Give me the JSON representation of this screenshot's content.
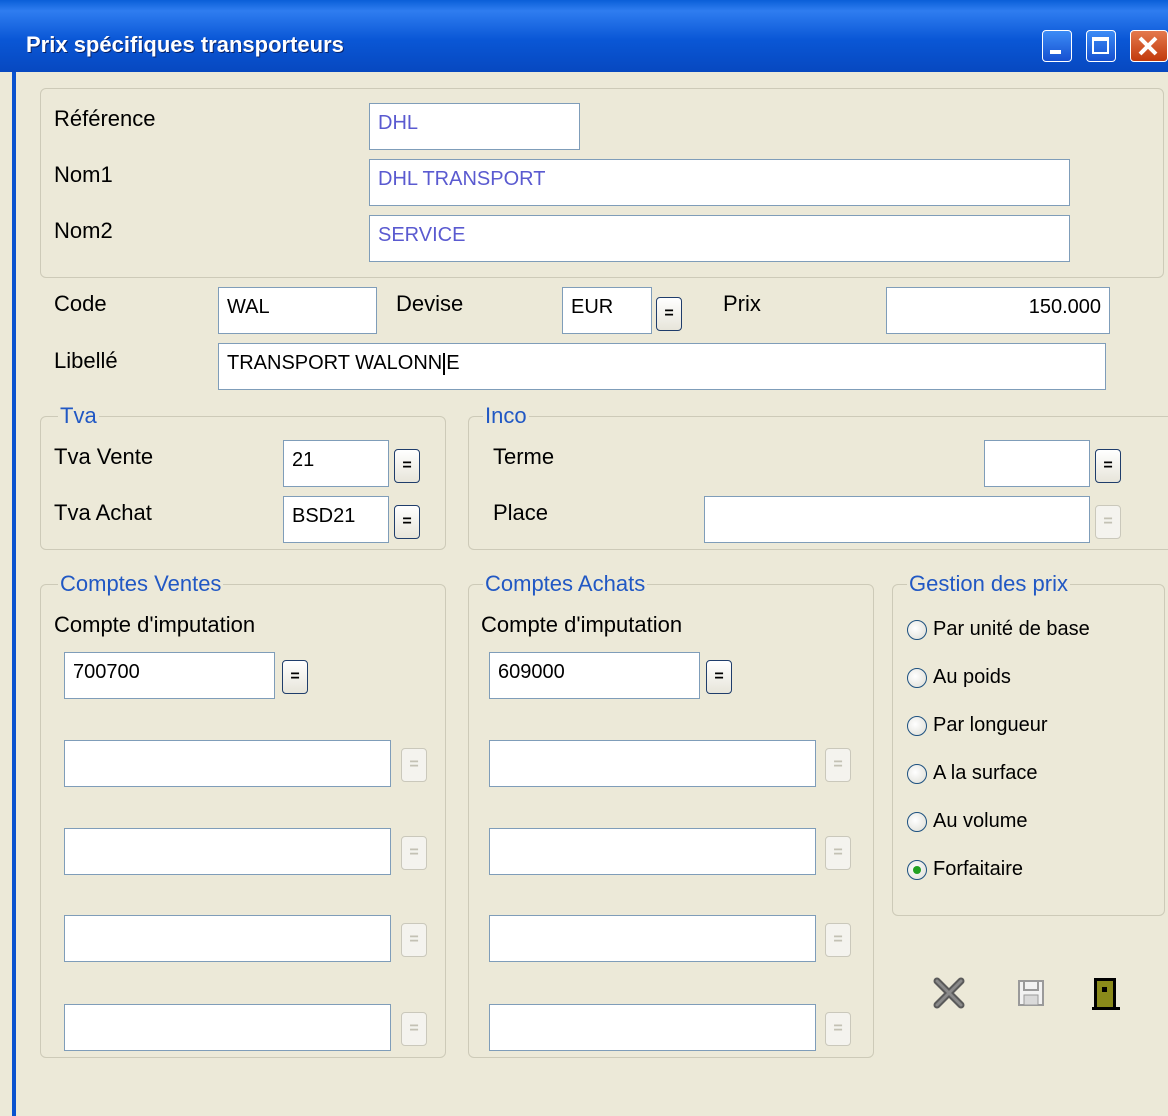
{
  "window": {
    "title": "Prix spécifiques transporteurs"
  },
  "carrier": {
    "reference_label": "Référence",
    "reference_value": "DHL",
    "nom1_label": "Nom1",
    "nom1_value": "DHL TRANSPORT",
    "nom2_label": "Nom2",
    "nom2_value": "SERVICE"
  },
  "line": {
    "code_label": "Code",
    "code_value": "WAL",
    "devise_label": "Devise",
    "devise_value": "EUR",
    "prix_label": "Prix",
    "prix_value": "150.000",
    "libelle_label": "Libellé",
    "libelle_before_caret": "TRANSPORT WALONN",
    "libelle_after_caret": "E"
  },
  "tva": {
    "legend": "Tva",
    "vente_label": "Tva Vente",
    "vente_value": "21",
    "achat_label": "Tva Achat",
    "achat_value": "BSD21"
  },
  "inco": {
    "legend": "Inco",
    "terme_label": "Terme",
    "terme_value": "",
    "place_label": "Place",
    "place_value": ""
  },
  "comptes_ventes": {
    "legend": "Comptes Ventes",
    "label": "Compte d'imputation",
    "value": "700700"
  },
  "comptes_achats": {
    "legend": "Comptes Achats",
    "label": "Compte d'imputation",
    "value": "609000"
  },
  "gestion_prix": {
    "legend": "Gestion des prix",
    "options": [
      "Par unité de base",
      "Au poids",
      "Par longueur",
      "A la surface",
      "Au volume",
      "Forfaitaire"
    ],
    "selected": "Forfaitaire"
  },
  "lookup_button_label": "=",
  "icons": {
    "minimize": "minimize-icon",
    "maximize": "maximize-icon",
    "close": "close-icon",
    "cancel": "cancel-x-icon",
    "save": "floppy-disk-icon",
    "exit": "exit-door-icon"
  },
  "colors": {
    "title_bar": "#0a57d6",
    "legend_text": "#2158c4",
    "field_value_blue": "#5a5ad0",
    "radio_checked": "#21a121"
  }
}
